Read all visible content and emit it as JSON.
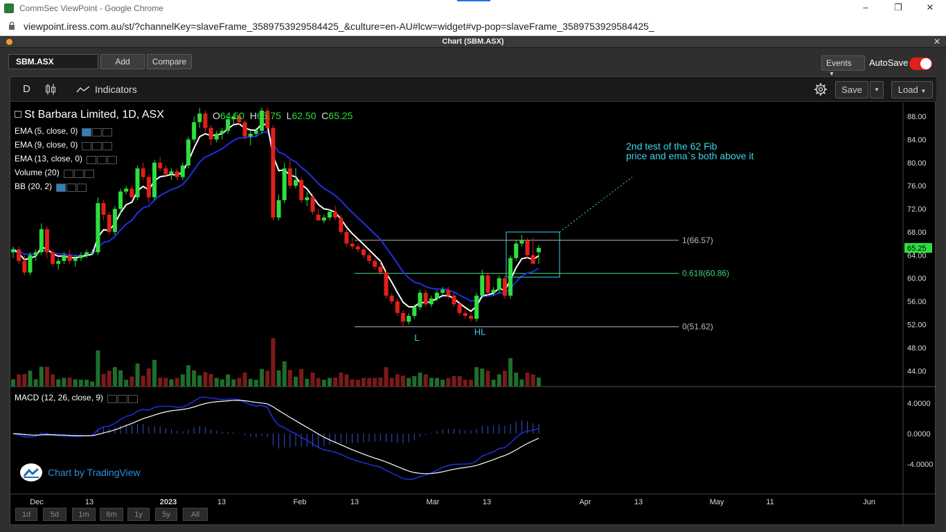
{
  "browser": {
    "window_title": "CommSec ViewPoint - Google Chrome",
    "url": "viewpoint.iress.com.au/st/?channelKey=slaveFrame_3589753929584425_&culture=en-AU#lcw=widget#vp-pop=slaveFrame_3589753929584425_"
  },
  "widget": {
    "title": "Chart (SBM.ASX)",
    "symbol": "SBM.ASX",
    "add_label": "Add",
    "compare_label": "Compare",
    "events_label": "Events",
    "autosave_label": "AutoSave"
  },
  "toolbar": {
    "interval": "D",
    "indicators_label": "Indicators",
    "save_label": "Save",
    "load_label": "Load"
  },
  "legend": {
    "title": "St Barbara Limited, 1D, ASX",
    "open_label": "O",
    "open": "64.50",
    "high_label": "H",
    "high": "65.75",
    "low_label": "L",
    "low": "62.50",
    "close_label": "C",
    "close": "65.25",
    "studies": [
      "EMA (5, close, 0)",
      "EMA (9, close, 0)",
      "EMA (13, close, 0)",
      "Volume (20)",
      "BB (20, 2)"
    ],
    "macd": "MACD (12, 26, close, 9)"
  },
  "annotation": {
    "line1": "2nd test of the 62 Fib",
    "line2": "price and ema`s both above it",
    "low_label": "L",
    "higher_low_label": "HL"
  },
  "brand": "Chart by TradingView",
  "ranges": [
    "1d",
    "5d",
    "1m",
    "6m",
    "1y",
    "5y",
    "All"
  ],
  "colors": {
    "up": "#2ddf3f",
    "down": "#e0201a",
    "fib": "#3ad6e6",
    "ema5": "#ffffff",
    "ema9": "#2030e0",
    "accent": "#f39b27"
  },
  "chart_data": {
    "type": "candlestick",
    "price_axis": [
      "88.00",
      "84.00",
      "80.00",
      "76.00",
      "72.00",
      "68.00",
      "64.00",
      "60.00",
      "56.00",
      "52.00",
      "48.00",
      "44.00"
    ],
    "last_price_label": "65.25",
    "macd_axis": [
      "4.0000",
      "0.0000",
      "-4.0000"
    ],
    "x_ticks": [
      "Dec",
      "13",
      "2023",
      "13",
      "Feb",
      "13",
      "Mar",
      "13",
      "Apr",
      "13",
      "May",
      "11",
      "Jun"
    ],
    "fib_levels": [
      {
        "label": "1(66.57)",
        "value": 66.57
      },
      {
        "label": "0.618(60.86)",
        "value": 60.86
      },
      {
        "label": "0(51.62)",
        "value": 51.62
      }
    ],
    "candles": [
      [
        64.5,
        65.5,
        63.5,
        65.0
      ],
      [
        65.0,
        65.5,
        62.5,
        63.0
      ],
      [
        63.0,
        64.0,
        60.5,
        61.0
      ],
      [
        61.0,
        64.5,
        60.5,
        64.0
      ],
      [
        64.0,
        65.0,
        63.0,
        64.5
      ],
      [
        64.5,
        69.5,
        64.0,
        68.5
      ],
      [
        68.5,
        69.0,
        63.5,
        64.5
      ],
      [
        64.5,
        65.0,
        62.0,
        62.5
      ],
      [
        62.5,
        63.5,
        61.5,
        63.0
      ],
      [
        63.0,
        64.5,
        62.5,
        64.0
      ],
      [
        64.0,
        65.0,
        62.5,
        63.0
      ],
      [
        63.0,
        64.0,
        62.0,
        63.5
      ],
      [
        63.5,
        64.5,
        63.0,
        64.0
      ],
      [
        64.0,
        65.0,
        63.5,
        64.5
      ],
      [
        64.5,
        65.0,
        64.0,
        64.5
      ],
      [
        64.5,
        74.0,
        64.0,
        73.0
      ],
      [
        73.0,
        73.5,
        70.0,
        71.0
      ],
      [
        71.0,
        71.5,
        67.5,
        68.0
      ],
      [
        68.0,
        72.5,
        67.5,
        72.0
      ],
      [
        72.0,
        75.5,
        71.0,
        75.0
      ],
      [
        75.0,
        76.0,
        74.5,
        75.5
      ],
      [
        75.5,
        76.0,
        74.0,
        74.0
      ],
      [
        74.0,
        79.5,
        73.5,
        79.0
      ],
      [
        79.0,
        80.0,
        77.0,
        77.5
      ],
      [
        77.5,
        78.0,
        73.0,
        74.0
      ],
      [
        74.0,
        80.5,
        73.5,
        80.0
      ],
      [
        80.0,
        81.0,
        78.5,
        79.0
      ],
      [
        79.0,
        79.5,
        77.5,
        78.0
      ],
      [
        78.0,
        79.0,
        77.0,
        78.5
      ],
      [
        78.5,
        79.0,
        77.0,
        77.5
      ],
      [
        77.5,
        80.0,
        77.0,
        79.5
      ],
      [
        79.5,
        84.5,
        79.0,
        84.0
      ],
      [
        84.0,
        88.0,
        83.5,
        87.0
      ],
      [
        87.0,
        89.5,
        86.0,
        88.5
      ],
      [
        88.5,
        89.0,
        85.0,
        86.0
      ],
      [
        86.0,
        86.5,
        83.0,
        84.0
      ],
      [
        84.0,
        85.5,
        83.5,
        85.0
      ],
      [
        85.0,
        86.0,
        84.0,
        85.5
      ],
      [
        85.5,
        88.0,
        85.0,
        87.5
      ],
      [
        87.5,
        88.5,
        86.5,
        88.0
      ],
      [
        88.0,
        88.5,
        86.5,
        87.0
      ],
      [
        87.0,
        87.5,
        84.0,
        84.5
      ],
      [
        84.5,
        85.5,
        83.0,
        85.0
      ],
      [
        85.0,
        86.0,
        84.5,
        85.5
      ],
      [
        85.5,
        89.5,
        85.0,
        89.0
      ],
      [
        89.0,
        89.5,
        85.5,
        86.0
      ],
      [
        86.0,
        86.5,
        70.0,
        70.5
      ],
      [
        70.5,
        74.5,
        70.0,
        73.5
      ],
      [
        73.5,
        80.0,
        73.0,
        79.0
      ],
      [
        79.0,
        80.5,
        75.5,
        76.0
      ],
      [
        76.0,
        79.0,
        75.5,
        77.0
      ],
      [
        77.0,
        77.5,
        73.0,
        73.5
      ],
      [
        73.5,
        75.0,
        72.5,
        74.0
      ],
      [
        74.0,
        74.5,
        71.0,
        71.5
      ],
      [
        71.0,
        72.0,
        70.0,
        70.0
      ],
      [
        70.0,
        71.0,
        69.5,
        70.5
      ],
      [
        70.5,
        72.0,
        70.0,
        71.5
      ],
      [
        71.5,
        72.5,
        70.0,
        70.5
      ],
      [
        70.5,
        71.0,
        67.5,
        68.0
      ],
      [
        68.0,
        68.5,
        65.5,
        66.0
      ],
      [
        66.0,
        67.0,
        65.0,
        65.5
      ],
      [
        65.5,
        66.0,
        64.5,
        65.0
      ],
      [
        65.0,
        65.5,
        63.5,
        64.0
      ],
      [
        64.0,
        64.5,
        62.5,
        63.0
      ],
      [
        63.0,
        63.5,
        61.5,
        62.0
      ],
      [
        62.0,
        63.0,
        60.5,
        61.0
      ],
      [
        61.0,
        61.5,
        56.5,
        57.0
      ],
      [
        57.0,
        57.5,
        55.5,
        56.0
      ],
      [
        56.0,
        56.5,
        53.5,
        54.0
      ],
      [
        54.0,
        54.5,
        51.5,
        52.5
      ],
      [
        52.5,
        54.0,
        52.0,
        53.5
      ],
      [
        53.5,
        55.5,
        53.0,
        55.0
      ],
      [
        55.0,
        58.0,
        54.5,
        57.5
      ],
      [
        57.5,
        58.0,
        55.0,
        55.5
      ],
      [
        55.5,
        57.0,
        55.0,
        56.5
      ],
      [
        56.5,
        58.0,
        56.0,
        57.5
      ],
      [
        57.5,
        58.5,
        57.0,
        58.0
      ],
      [
        58.0,
        58.5,
        56.5,
        57.0
      ],
      [
        57.0,
        57.5,
        55.0,
        55.5
      ],
      [
        55.5,
        56.0,
        53.5,
        54.0
      ],
      [
        54.0,
        54.5,
        53.0,
        53.5
      ],
      [
        53.5,
        54.0,
        52.5,
        53.0
      ],
      [
        53.0,
        57.5,
        52.5,
        57.0
      ],
      [
        57.0,
        61.5,
        56.5,
        60.5
      ],
      [
        60.5,
        61.0,
        57.0,
        57.5
      ],
      [
        57.5,
        58.5,
        57.0,
        58.0
      ],
      [
        58.0,
        60.5,
        57.5,
        60.0
      ],
      [
        60.0,
        60.5,
        56.5,
        57.0
      ],
      [
        57.0,
        64.0,
        56.5,
        63.5
      ],
      [
        63.5,
        66.5,
        63.0,
        66.0
      ],
      [
        66.0,
        67.5,
        65.5,
        66.5
      ],
      [
        66.5,
        67.0,
        63.5,
        64.0
      ],
      [
        64.0,
        67.0,
        62.5,
        62.5
      ],
      [
        64.5,
        65.75,
        62.5,
        65.25
      ]
    ]
  }
}
